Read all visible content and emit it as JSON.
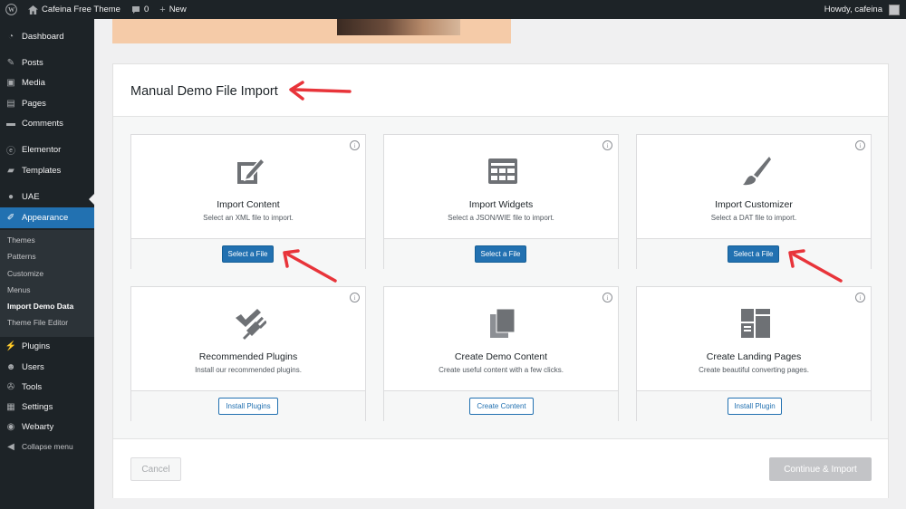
{
  "admin_bar": {
    "site_name": "Cafeina Free Theme",
    "comments_count": "0",
    "new_label": "New",
    "howdy": "Howdy, cafeina"
  },
  "sidebar": {
    "items": [
      {
        "label": "Dashboard",
        "icon": "dashboard-icon"
      },
      {
        "label": "Posts",
        "icon": "pin-icon"
      },
      {
        "label": "Media",
        "icon": "media-icon"
      },
      {
        "label": "Pages",
        "icon": "pages-icon"
      },
      {
        "label": "Comments",
        "icon": "comment-icon"
      },
      {
        "label": "Elementor",
        "icon": "elementor-icon"
      },
      {
        "label": "Templates",
        "icon": "folder-icon"
      },
      {
        "label": "UAE",
        "icon": "uae-icon"
      },
      {
        "label": "Appearance",
        "icon": "brush-icon"
      },
      {
        "label": "Plugins",
        "icon": "plugin-icon"
      },
      {
        "label": "Users",
        "icon": "users-icon"
      },
      {
        "label": "Tools",
        "icon": "wrench-icon"
      },
      {
        "label": "Settings",
        "icon": "settings-icon"
      },
      {
        "label": "Webarty",
        "icon": "webarty-icon"
      },
      {
        "label": "Collapse menu",
        "icon": "collapse-icon"
      }
    ],
    "submenu": [
      "Themes",
      "Patterns",
      "Customize",
      "Menus",
      "Import Demo Data",
      "Theme File Editor"
    ]
  },
  "panel": {
    "title": "Manual Demo File Import",
    "cards": [
      {
        "title": "Import Content",
        "desc": "Select an XML file to import.",
        "button": "Select a File",
        "icon": "import-content-icon"
      },
      {
        "title": "Import Widgets",
        "desc": "Select a JSON/WIE file to import.",
        "button": "Select a File",
        "icon": "widgets-icon"
      },
      {
        "title": "Import Customizer",
        "desc": "Select a DAT file to import.",
        "button": "Select a File",
        "icon": "paintbrush-icon"
      },
      {
        "title": "Recommended Plugins",
        "desc": "Install our recommended plugins.",
        "button": "Install Plugins",
        "icon": "plugins-icon"
      },
      {
        "title": "Create Demo Content",
        "desc": "Create useful content with a few clicks.",
        "button": "Create Content",
        "icon": "copy-icon"
      },
      {
        "title": "Create Landing Pages",
        "desc": "Create beautiful converting pages.",
        "button": "Install Plugin",
        "icon": "landing-pages-icon"
      }
    ],
    "cancel": "Cancel",
    "continue": "Continue & Import"
  },
  "colors": {
    "accent": "#2271b1",
    "annotation_arrow": "#e8343a"
  }
}
